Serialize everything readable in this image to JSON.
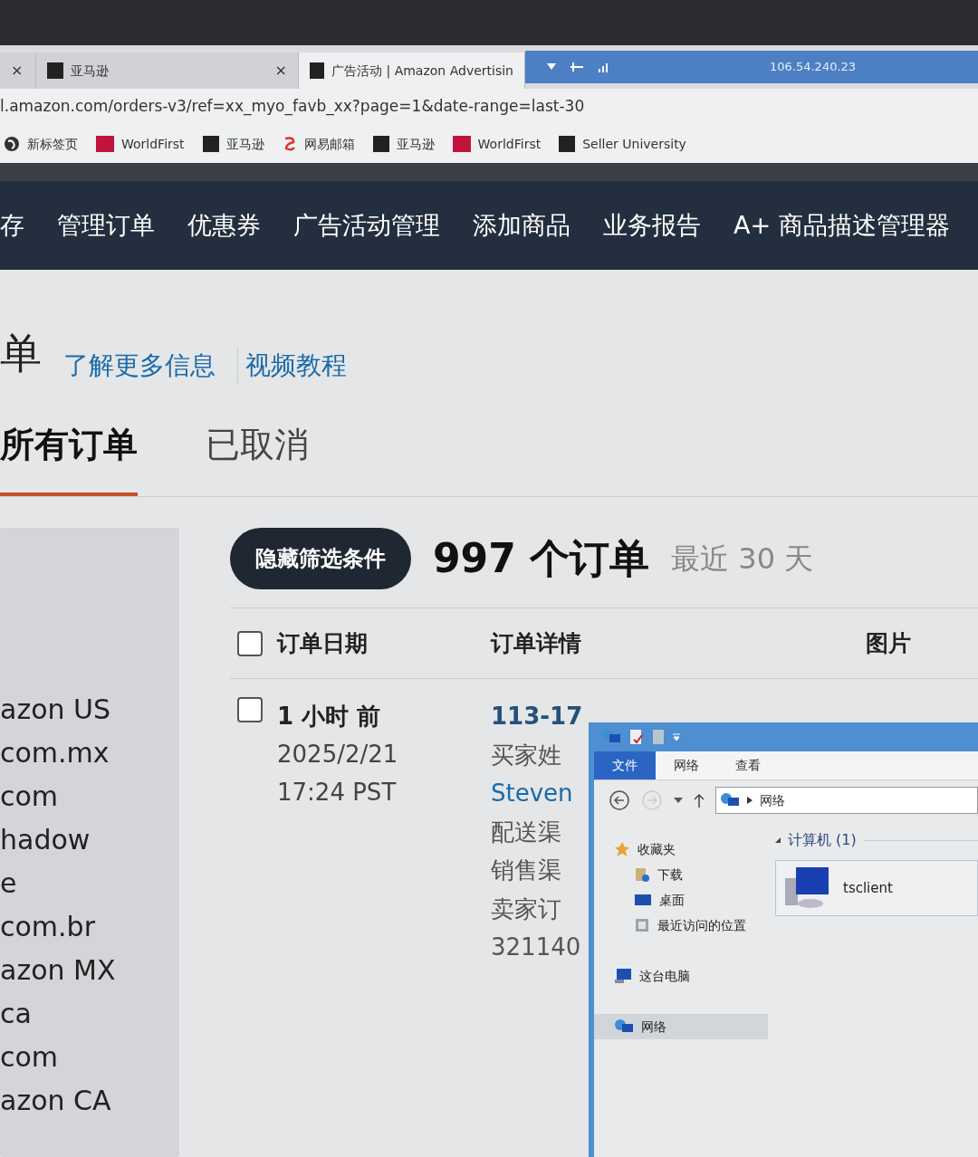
{
  "browser": {
    "tabs": [
      {
        "close": "×",
        "selected": false
      },
      {
        "title": "亚马逊",
        "close": "×",
        "selected": false
      },
      {
        "title": "广告活动 | Amazon Advertisin",
        "selected": true
      }
    ],
    "remote_bar": {
      "ip": "106.54.240.23"
    },
    "url": "l.amazon.com/orders-v3/ref=xx_myo_favb_xx?page=1&date-range=last-30",
    "bookmarks": [
      {
        "kind": "globe",
        "label": "新标签页"
      },
      {
        "kind": "w",
        "label": "WorldFirst"
      },
      {
        "kind": "a",
        "label": "亚马逊"
      },
      {
        "kind": "mail",
        "label": "网易邮箱"
      },
      {
        "kind": "a",
        "label": "亚马逊"
      },
      {
        "kind": "w",
        "label": "WorldFirst"
      },
      {
        "kind": "a",
        "label": "Seller University"
      }
    ]
  },
  "nav": [
    "存",
    "管理订单",
    "优惠券",
    "广告活动管理",
    "添加商品",
    "业务报告",
    "A+ 商品描述管理器"
  ],
  "page": {
    "title": "单",
    "links": [
      "了解更多信息",
      "视频教程"
    ]
  },
  "tabs": [
    {
      "label": "所有订单",
      "selected": true
    },
    {
      "label": "已取消",
      "selected": false
    }
  ],
  "filters": [
    "azon US",
    "com.mx",
    "com",
    "hadow",
    "e",
    "com.br",
    "azon MX",
    "ca",
    "com",
    "azon CA"
  ],
  "toolbar": {
    "filter_button": "隐藏筛选条件",
    "count": "997 个订单",
    "range": "最近 30 天"
  },
  "table": {
    "select_all": {
      "checked": false
    },
    "columns": [
      "订单日期",
      "订单详情",
      "图片"
    ],
    "rows": [
      {
        "checked": false,
        "date": [
          "1 小时 前",
          "2025/2/21",
          "17:24 PST"
        ],
        "details": [
          "113-17",
          "买家姓",
          "Steven",
          "配送渠",
          "销售渠",
          "卖家订",
          "321140"
        ]
      }
    ]
  },
  "explorer": {
    "ribbon_tabs": [
      {
        "label": "文件",
        "selected": true
      },
      {
        "label": "网络",
        "selected": false
      },
      {
        "label": "查看",
        "selected": false
      }
    ],
    "address": "网络",
    "sidebar": [
      {
        "kind": "star",
        "label": "收藏夹",
        "selected": false
      },
      {
        "kind": "download",
        "label": "下载",
        "selected": false
      },
      {
        "kind": "desktop",
        "label": "桌面",
        "selected": false
      },
      {
        "kind": "recent",
        "label": "最近访问的位置",
        "selected": false
      },
      {
        "kind": "pc",
        "label": "这台电脑",
        "selected": false
      },
      {
        "kind": "network",
        "label": "网络",
        "selected": true
      }
    ],
    "group": "计算机 (1)",
    "items": [
      "tsclient"
    ]
  }
}
